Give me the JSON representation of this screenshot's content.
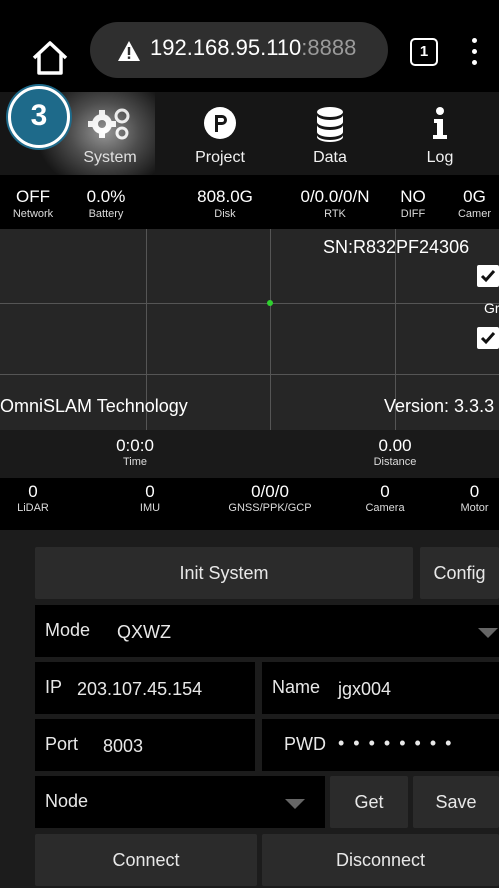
{
  "browser": {
    "url_host": "192.168.95.110",
    "url_port": ":8888",
    "tab_count": "1"
  },
  "badge": {
    "number": "3"
  },
  "nav": [
    {
      "label": "System",
      "icon": "gears-icon"
    },
    {
      "label": "Project",
      "icon": "project-p-icon"
    },
    {
      "label": "Data",
      "icon": "database-icon"
    },
    {
      "label": "Log",
      "icon": "info-icon"
    }
  ],
  "status": [
    {
      "value": "OFF",
      "label": "Network"
    },
    {
      "value": "0.0%",
      "label": "Battery"
    },
    {
      "value": "808.0G",
      "label": "Disk"
    },
    {
      "value": "0/0.0/0/N",
      "label": "RTK"
    },
    {
      "value": "NO",
      "label": "DIFF"
    },
    {
      "value": "0G",
      "label": "Camer"
    }
  ],
  "map": {
    "serial": "SN:R832PF24306",
    "grid_label": "Gric",
    "brand": "OmniSLAM Technology",
    "version": "Version: 3.3.3"
  },
  "metrics": {
    "time_value": "0:0:0",
    "time_label": "Time",
    "distance_value": "0.00",
    "distance_label": "Distance"
  },
  "counters": [
    {
      "value": "0",
      "label": "LiDAR"
    },
    {
      "value": "0",
      "label": "IMU"
    },
    {
      "value": "0/0/0",
      "label": "GNSS/PPK/GCP"
    },
    {
      "value": "0",
      "label": "Camera"
    },
    {
      "value": "0",
      "label": "Motor"
    }
  ],
  "panel": {
    "init_label": "Init System",
    "config_label": "Config",
    "mode_label": "Mode",
    "mode_value": "QXWZ",
    "ip_label": "IP",
    "ip_value": "203.107.45.154",
    "name_label": "Name",
    "name_value": "jgx004",
    "port_label": "Port",
    "port_value": "8003",
    "pwd_label": "PWD",
    "pwd_value": "• • • • • • • •",
    "node_label": "Node",
    "get_label": "Get",
    "save_label": "Save",
    "connect_label": "Connect",
    "disconnect_label": "Disconnect"
  }
}
